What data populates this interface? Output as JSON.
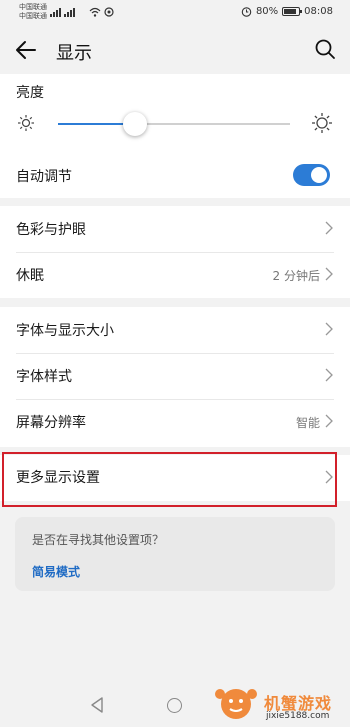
{
  "status_bar": {
    "carrier1": "中国联通",
    "carrier2": "中国联通",
    "battery": "80%",
    "time": "08:08"
  },
  "header": {
    "title": "显示"
  },
  "brightness": {
    "label": "亮度",
    "level": 0.33
  },
  "auto_adjust": {
    "label": "自动调节",
    "enabled": true
  },
  "group1": [
    {
      "label": "色彩与护眼",
      "value": ""
    },
    {
      "label": "休眠",
      "value": "2 分钟后"
    }
  ],
  "group2": [
    {
      "label": "字体与显示大小",
      "value": ""
    },
    {
      "label": "字体样式",
      "value": ""
    },
    {
      "label": "屏幕分辨率",
      "value": "智能"
    }
  ],
  "group3": [
    {
      "label": "更多显示设置",
      "value": ""
    }
  ],
  "suggestion": {
    "question": "是否在寻找其他设置项？",
    "link": "简易模式"
  },
  "watermark": {
    "brand": "机蟹游戏",
    "url": "jixie5188.com"
  },
  "colors": {
    "accent": "#2c7cd6",
    "highlight": "#d2202a",
    "link": "#1f6bc4"
  }
}
